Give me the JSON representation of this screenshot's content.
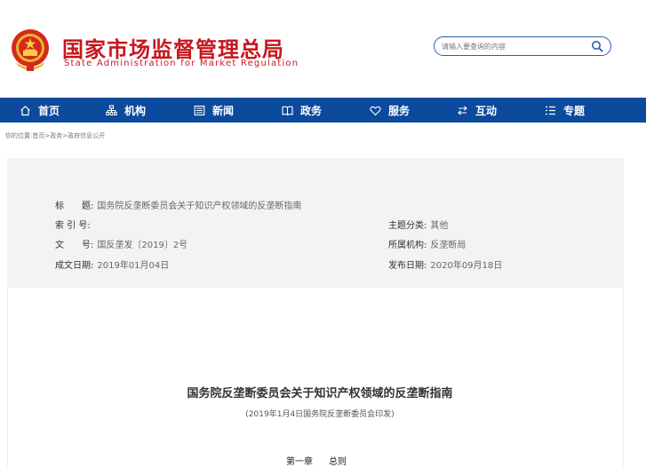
{
  "header": {
    "title_cn": "国家市场监督管理总局",
    "title_en": "State Administration for Market Regulation",
    "search_placeholder": "请输入要查询的内容"
  },
  "nav": {
    "items": [
      {
        "label": "首页",
        "icon": "home-icon"
      },
      {
        "label": "机构",
        "icon": "org-icon"
      },
      {
        "label": "新闻",
        "icon": "news-icon"
      },
      {
        "label": "政务",
        "icon": "affairs-icon"
      },
      {
        "label": "服务",
        "icon": "heart-icon"
      },
      {
        "label": "互动",
        "icon": "arrows-icon"
      },
      {
        "label": "专题",
        "icon": "topic-icon"
      }
    ]
  },
  "breadcrumb": {
    "prefix": "你的位置:",
    "items": [
      "首页",
      "政务",
      "政府信息公开"
    ],
    "separator": ">"
  },
  "info": {
    "title_label": "标　　题:",
    "title_value": "国务院反垄断委员会关于知识产权领域的反垄断指南",
    "index_label": "索 引 号:",
    "index_value": "",
    "topic_label": "主题分类:",
    "topic_value": "其他",
    "docno_label": "文　　号:",
    "docno_value": "国反垄发〔2019〕2号",
    "org_label": "所属机构:",
    "org_value": "反垄断局",
    "created_label": "成文日期:",
    "created_value": "2019年01月04日",
    "published_label": "发布日期:",
    "published_value": "2020年09月18日"
  },
  "article": {
    "title": "国务院反垄断委员会关于知识产权领域的反垄断指南",
    "subtitle": "(2019年1月4日国务院反垄断委员会印发)",
    "chapter_num": "第一章",
    "chapter_name": "总则"
  },
  "colors": {
    "brand_red": "#c8161d",
    "nav_blue": "#0b4a9c",
    "info_bg": "#f3f3f3"
  }
}
